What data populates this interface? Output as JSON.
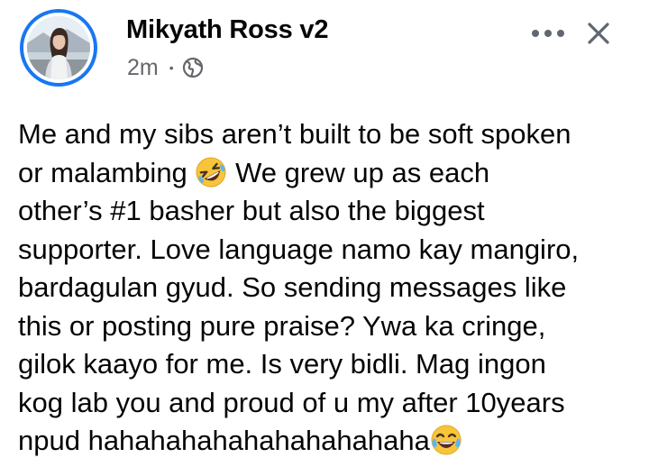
{
  "post": {
    "author_name": "Mikyath Ross v2",
    "timestamp": "2m",
    "separator": "•",
    "audience_icon": "globe-icon",
    "avatar_icon": "profile-photo",
    "header_actions": {
      "more_icon": "more-horizontal-icon",
      "close_icon": "close-icon"
    },
    "lines": [
      {
        "text": "Me and my sibs aren’t built to be soft spoken"
      },
      {
        "text": "or malambing",
        "emoji": "rolling-on-floor-laughing-emoji",
        "after": " We grew up as each"
      },
      {
        "text": "other’s #1 basher but also the biggest"
      },
      {
        "text": "supporter. Love language namo kay mangiro,"
      },
      {
        "text": "bardagulan gyud. So sending messages like"
      },
      {
        "text": "this or posting pure praise? Ywa ka cringe,"
      },
      {
        "text": "gilok kaayo for me. Is very bidli. Mag ingon"
      },
      {
        "text": "kog lab you and proud of u my after 10years"
      },
      {
        "text": "npud hahahahahahahahahahaha",
        "emoji": "tears-of-joy-emoji"
      }
    ]
  },
  "colors": {
    "accent": "#1877f2",
    "text": "#050505",
    "secondary_text": "#65676b",
    "icon": "#606770",
    "emoji_yellow": "#f7c53b"
  }
}
